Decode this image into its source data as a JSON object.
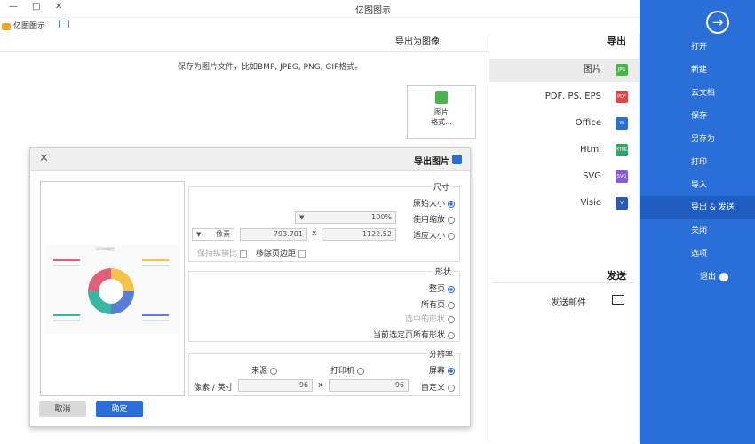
{
  "window": {
    "title": "亿图图示",
    "controls": [
      "—",
      "□",
      "✕"
    ]
  },
  "brand": {
    "name": "亿图图示"
  },
  "sidebar": {
    "items": [
      {
        "label": "打开"
      },
      {
        "label": "新建"
      },
      {
        "label": "云文档"
      },
      {
        "label": "保存"
      },
      {
        "label": "另存为"
      },
      {
        "label": "打印"
      },
      {
        "label": "导入"
      },
      {
        "label": "导出 & 发送"
      },
      {
        "label": "关闭"
      },
      {
        "label": "选项"
      },
      {
        "label": "退出"
      }
    ],
    "active_index": 7
  },
  "export": {
    "title": "导出",
    "formats": [
      {
        "label": "图片",
        "icon": "JPG",
        "color": "#4ab34a"
      },
      {
        "label": "PDF, PS, EPS",
        "icon": "PDF",
        "color": "#e04848"
      },
      {
        "label": "Office",
        "icon": "W",
        "color": "#2a6ed8"
      },
      {
        "label": "Html",
        "icon": "HTML",
        "color": "#3aa06a"
      },
      {
        "label": "SVG",
        "icon": "SVG",
        "color": "#8a5ad8"
      },
      {
        "label": "Visio",
        "icon": "V",
        "color": "#2a5ab8"
      }
    ],
    "send_title": "发送",
    "send_mail": "发送邮件"
  },
  "main": {
    "title": "导出为图像",
    "description": "保存为图片文件，比如BMP, JPEG, PNG, GIF格式。",
    "card_label_1": "图片",
    "card_label_2": "格式..."
  },
  "dialog": {
    "title": "导出图片",
    "size_group": {
      "title": "尺寸",
      "original": "原始大小",
      "scale": "使用缩放",
      "scale_value": "100%",
      "fit": "适应大小",
      "width": "1122.52",
      "height": "793.701",
      "unit": "像素",
      "remove_margin": "移除页边距",
      "keep_ratio": "保持纵横比"
    },
    "shape_group": {
      "title": "形状",
      "all_pages": "整页",
      "current_page": "所有页",
      "selected_shapes": "选中的形状",
      "current_all": "当前选定页所有形状"
    },
    "resolution_group": {
      "title": "分辨率",
      "screen": "屏幕",
      "printer": "打印机",
      "source": "来源",
      "custom": "自定义",
      "x_value": "96",
      "y_value": "96",
      "res_unit": "像素 / 英寸"
    },
    "preview_title": "GROW模型",
    "ok": "确定",
    "cancel": "取消"
  }
}
